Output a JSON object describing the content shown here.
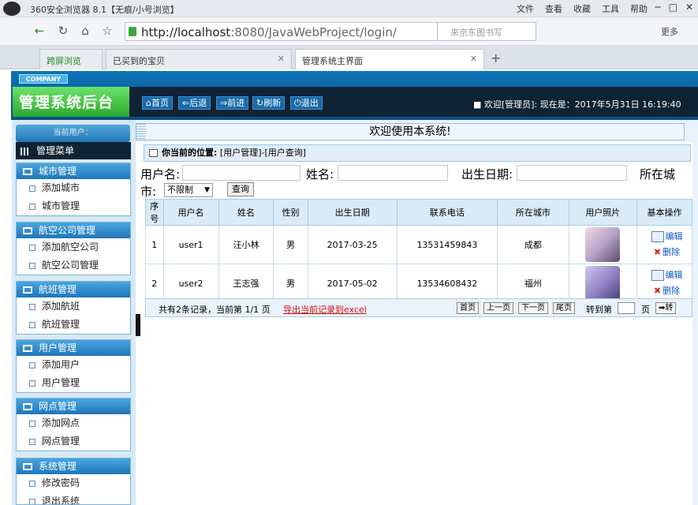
{
  "browser": {
    "title": "360安全浏览器 8.1【无痕/小号浏览】",
    "menus": [
      "文件",
      "查看",
      "收藏",
      "工具",
      "帮助"
    ],
    "url_host": "http://localhost",
    "url_path": ":8080/JavaWebProject/login/",
    "search_placeholder": "来京东图书写",
    "ext_more": "更多"
  },
  "tabs": [
    {
      "label": "跨屏浏览"
    },
    {
      "label": "已买到的宝贝"
    },
    {
      "label": "管理系统主界面"
    }
  ],
  "header": {
    "company": "COMPANY",
    "brand": "管理系统后台",
    "nav": [
      "首页",
      "后退",
      "前进",
      "刷新",
      "退出"
    ],
    "welcome": "欢迎[管理员]:   现在是：2017年5月31日  16:19:40"
  },
  "sidebar": {
    "current_user": "当前用户：",
    "main_menu": "管理菜单",
    "groups": [
      {
        "title": "城市管理",
        "items": [
          "添加城市",
          "城市管理"
        ]
      },
      {
        "title": "航空公司管理",
        "items": [
          "添加航空公司",
          "航空公司管理"
        ]
      },
      {
        "title": "航班管理",
        "items": [
          "添加航班",
          "航班管理"
        ]
      },
      {
        "title": "用户管理",
        "items": [
          "添加用户",
          "用户管理"
        ]
      },
      {
        "title": "网点管理",
        "items": [
          "添加网点",
          "网点管理"
        ]
      },
      {
        "title": "系统管理",
        "items": [
          "修改密码",
          "退出系统"
        ]
      }
    ]
  },
  "main": {
    "welcome": "欢迎使用本系统!",
    "position_label": "你当前的位置:",
    "position_path": "[用户管理]-[用户查询]",
    "filters": {
      "username_label": "用户名:",
      "name_label": "姓名:",
      "birth_label": "出生日期:",
      "city_label": "所在城",
      "city_label_wrap": "市:",
      "city_value": "不限制",
      "query_button": "查询"
    },
    "table": {
      "headers": [
        "序号",
        "用户名",
        "姓名",
        "性别",
        "出生日期",
        "联系电话",
        "所在城市",
        "用户照片",
        "基本操作"
      ],
      "rows": [
        [
          "1",
          "user1",
          "汪小林",
          "男",
          "2017-03-25",
          "13531459843",
          "成都"
        ],
        [
          "2",
          "user2",
          "王志强",
          "男",
          "2017-05-02",
          "13534608432",
          "福州"
        ]
      ],
      "edit_label": "编辑",
      "delete_label": "删除"
    },
    "pager": {
      "summary": "共有2条记录，当前第 1/1 页",
      "export": "导出当前记录到excel",
      "first": "首页",
      "prev": "上一页",
      "next": "下一页",
      "last": "尾页",
      "goto": "转到第",
      "page_unit": "页",
      "go": "转"
    }
  }
}
